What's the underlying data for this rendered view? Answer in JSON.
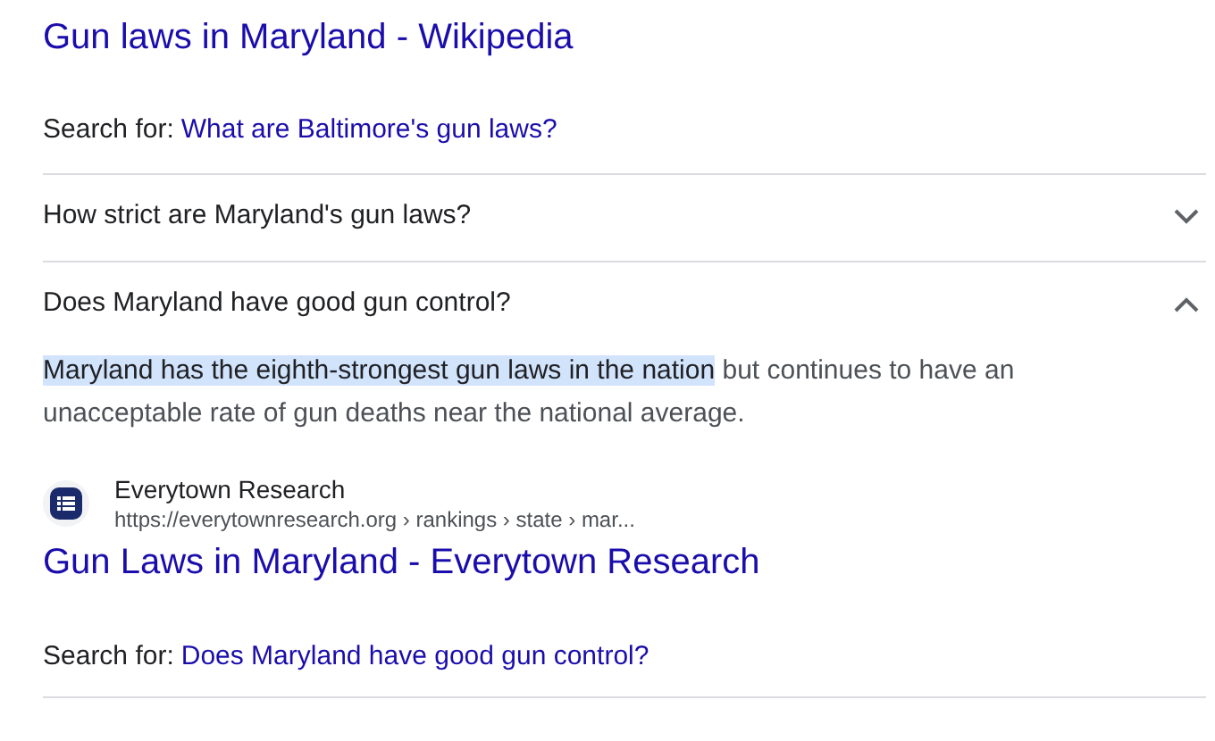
{
  "result_title": "Gun laws in Maryland - Wikipedia",
  "search_for": {
    "label": "Search for:",
    "query": "What are Baltimore's gun laws?"
  },
  "questions": [
    {
      "text": "How strict are Maryland's gun laws?",
      "expanded": false
    },
    {
      "text": "Does Maryland have good gun control?",
      "expanded": true,
      "answer": {
        "highlight": "Maryland has the eighth-strongest gun laws in the nation",
        "rest": " but continues to have an unacceptable rate of gun deaths near the national average."
      },
      "source": {
        "name": "Everytown Research",
        "url": "https://everytownresearch.org › rankings › state › mar..."
      },
      "title": "Gun Laws in Maryland - Everytown Research",
      "search_for": {
        "label": "Search for:",
        "query": "Does Maryland have good gun control?"
      }
    }
  ]
}
